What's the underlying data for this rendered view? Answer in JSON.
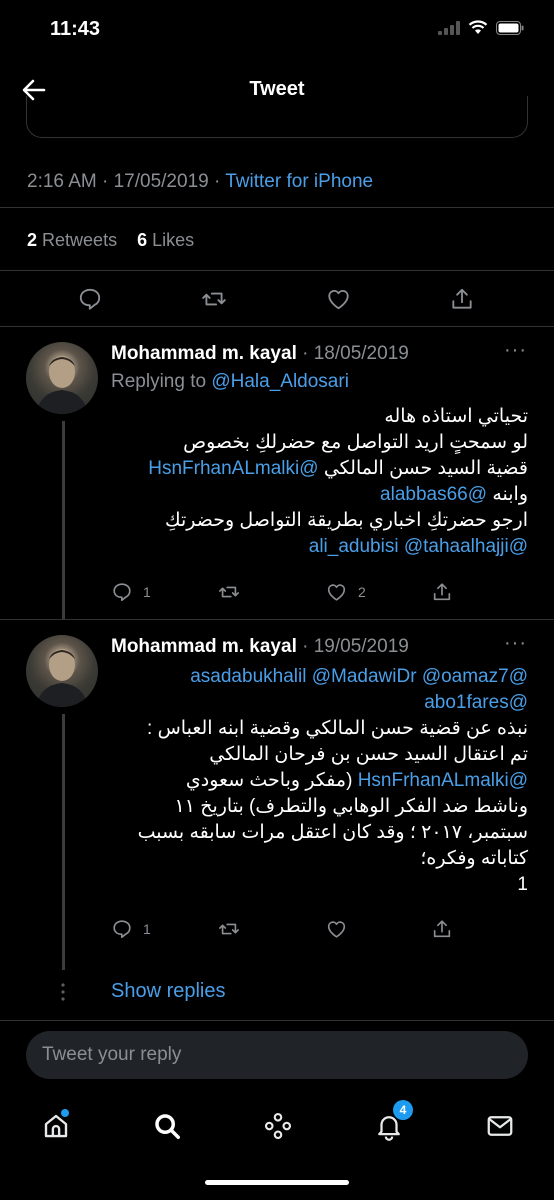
{
  "status_bar": {
    "time": "11:43"
  },
  "header": {
    "title": "Tweet"
  },
  "tweet": {
    "time": "2:16 AM",
    "date": "17/05/2019",
    "source": "Twitter for iPhone",
    "retweets_count": "2",
    "retweets_label": "Retweets",
    "likes_count": "6",
    "likes_label": "Likes"
  },
  "replies": [
    {
      "author": "Mohammad m. kayal",
      "date": "18/05/2019",
      "replying_to_label": "Replying to",
      "replying_to_handle": "@Hala_Aldosari",
      "body_lines": [
        "تحياتي استاذه هاله",
        "لو سمحتٍ اريد التواصل مع حضرلكِ بخصوص",
        "قضية السيد حسن المالكي",
        "@HsnFrhanALmalki",
        "وابنه",
        "@alabbas66",
        "ارجو حضرتكِ اخباري بطريقة التواصل وحضرتكِ",
        "@ali_adubisi",
        "@tahaalhajji"
      ],
      "reply_count": "1",
      "retweet_count": "",
      "like_count": "2"
    },
    {
      "author": "Mohammad m. kayal",
      "date": "19/05/2019",
      "body_lines": [
        "@asadabukhalil",
        "@MadawiDr",
        "@oamaz7",
        "@abo1fares",
        "نبذه عن قضية حسن المالكي  وقضية ابنه العباس :",
        "تم اعتقال السيد حسن بن فرحان المالكي",
        "@HsnFrhanALmalki",
        "(مفكر وباحث سعودي",
        "وناشط ضد الفكر الوهابي والتطرف)  بتاريخ ١١",
        "سبتمبر، ٢٠١٧ ؛ وقد كان اعتقل مرات سابقه بسبب",
        "كتاباته وفكره؛",
        "1"
      ],
      "reply_count": "1",
      "retweet_count": "",
      "like_count": ""
    }
  ],
  "show_replies": "Show replies",
  "composer": {
    "placeholder": "Tweet your reply"
  },
  "bottom_nav": {
    "notifications_badge": "4"
  },
  "colors": {
    "background": "#000000",
    "link": "#4a9fe8",
    "muted": "#8b8f94",
    "badge": "#1d9bf0"
  }
}
